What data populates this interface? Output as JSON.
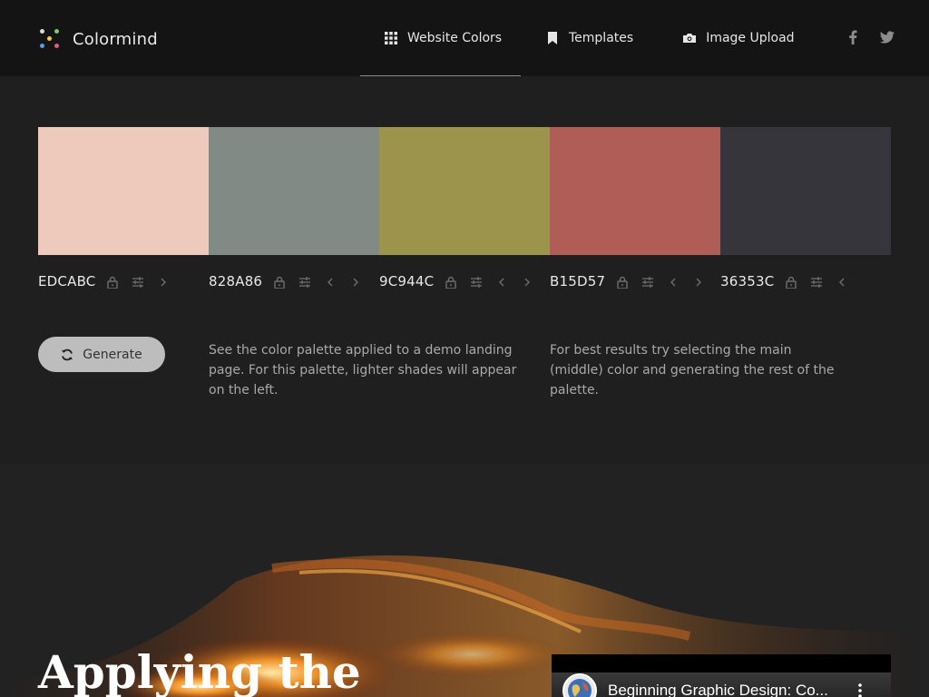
{
  "brand": {
    "name": "Colormind"
  },
  "nav": {
    "items": [
      {
        "label": "Website Colors",
        "icon": "grid-icon",
        "active": true
      },
      {
        "label": "Templates",
        "icon": "bookmark-icon",
        "active": false
      },
      {
        "label": "Image Upload",
        "icon": "camera-icon",
        "active": false
      }
    ],
    "social": [
      "facebook-icon",
      "twitter-icon"
    ]
  },
  "palette": {
    "colors": [
      {
        "hex": "EDCABC",
        "color": "#EDCABC"
      },
      {
        "hex": "828A86",
        "color": "#828A86"
      },
      {
        "hex": "9C944C",
        "color": "#9C944C"
      },
      {
        "hex": "B15D57",
        "color": "#B15D57"
      },
      {
        "hex": "36353C",
        "color": "#36353C"
      }
    ]
  },
  "actions": {
    "generate_label": "Generate"
  },
  "notes": {
    "left": "See the color palette applied to a demo landing page. For this palette, lighter shades will appear on the left.",
    "right": "For best results try selecting the main (middle) color and generating the rest of the palette."
  },
  "hero": {
    "title": "Applying the",
    "video_title": "Beginning Graphic Design: Co..."
  },
  "theme": {
    "header_bg": "#141414",
    "page_bg": "#1f1f1f",
    "icon_muted": "#6e6e6e"
  }
}
